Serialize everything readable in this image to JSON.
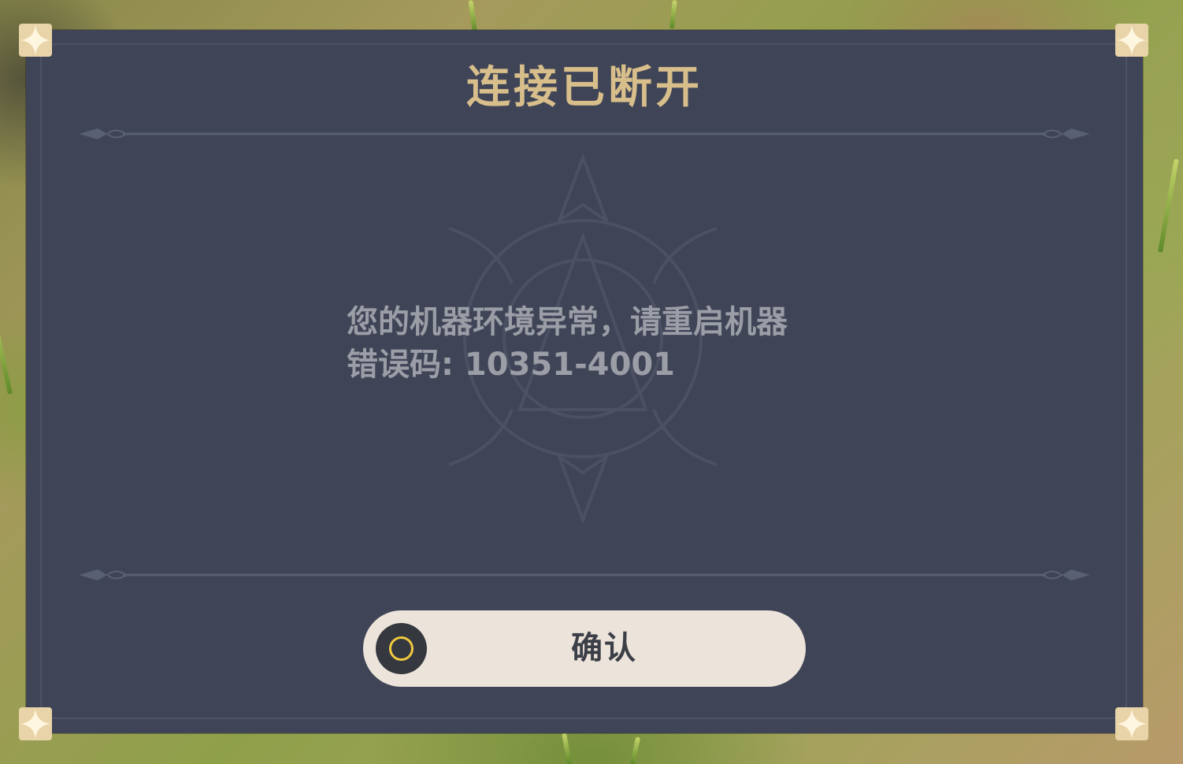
{
  "dialog": {
    "title": "连接已断开",
    "message_line_1": "您的机器环境异常，请重启机器",
    "message_line_2": "错误码: 10351-4001",
    "confirm_label": "确认"
  },
  "colors": {
    "dialog_background": "#3f4457",
    "title": "#d7be8a",
    "message": "#9b9ea6",
    "button_background": "#ece4da",
    "button_icon_ring": "#f0c93e"
  },
  "icons": {
    "confirm_button_icon": "circle-button-icon",
    "corner_ornament": "four-point-star-corner-icon"
  }
}
